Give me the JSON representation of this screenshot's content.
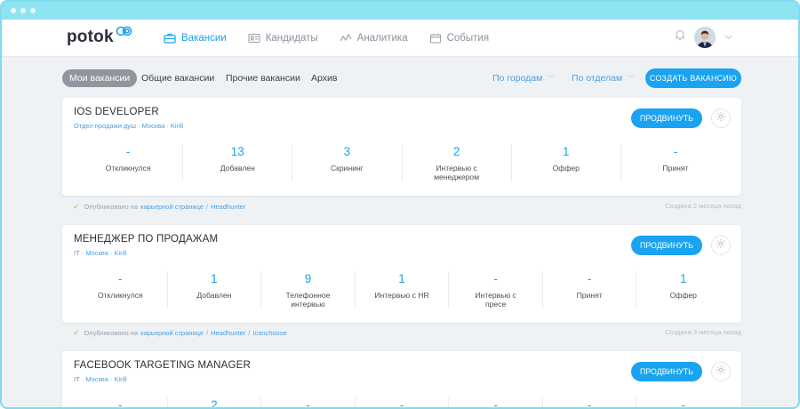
{
  "nav": {
    "logo": "potok",
    "items": [
      {
        "label": "Вакансии",
        "active": true,
        "icon": "briefcase-icon"
      },
      {
        "label": "Кандидаты",
        "active": false,
        "icon": "id-card-icon"
      },
      {
        "label": "Аналитика",
        "active": false,
        "icon": "analytics-icon"
      },
      {
        "label": "События",
        "active": false,
        "icon": "calendar-icon"
      }
    ]
  },
  "filters": {
    "tabs": [
      "Мои вакансии",
      "Общие вакансии",
      "Прочие вакансии",
      "Архив"
    ],
    "active_tab": "Мои вакансии",
    "city_filter": "По городам",
    "dept_filter": "По отделам",
    "create_button": "СОЗДАТЬ ВАКАНСИЮ"
  },
  "vacancies": [
    {
      "title": "IOS DEVELOPER",
      "meta": "Отдел продажи душ · Москва · Kirill",
      "promote": "ПРОДВИНУТЬ",
      "stages": [
        {
          "count": "-",
          "label": "Откликнулся"
        },
        {
          "count": "13",
          "label": "Добавлен"
        },
        {
          "count": "3",
          "label": "Скрининг"
        },
        {
          "count": "2",
          "label": "Интервью с менеджером"
        },
        {
          "count": "1",
          "label": "Оффер"
        },
        {
          "count": "-",
          "label": "Принят"
        }
      ],
      "published": {
        "prefix": "Опубликовано на",
        "links": [
          "карьерной странице",
          "Headhunter"
        ],
        "created": "Создана 2 месяца назад"
      }
    },
    {
      "title": "МЕНЕДЖЕР ПО ПРОДАЖАМ",
      "meta": "IT · Москва · Kirill",
      "promote": "ПРОДВИНУТЬ",
      "stages": [
        {
          "count": "-",
          "label": "Откликнулся"
        },
        {
          "count": "1",
          "label": "Добавлен"
        },
        {
          "count": "9",
          "label": "Телефонное интервью"
        },
        {
          "count": "1",
          "label": "Интервью с HR"
        },
        {
          "count": "-",
          "label": "Интервью с пресе"
        },
        {
          "count": "-",
          "label": "Принят"
        },
        {
          "count": "1",
          "label": "Оффер"
        }
      ],
      "published": {
        "prefix": "Опубликовано на",
        "links": [
          "карьерной странице",
          "Headhunter",
          "Icanchoose"
        ],
        "created": "Создана 3 месяца назад"
      }
    },
    {
      "title": "FACEBOOK TARGETING MANAGER",
      "meta": "IT · Москва · Kirill",
      "promote": "ПРОДВИНУТЬ",
      "stages": [
        {
          "count": "-",
          "label": ""
        },
        {
          "count": "2",
          "label": ""
        },
        {
          "count": "-",
          "label": ""
        },
        {
          "count": "-",
          "label": ""
        },
        {
          "count": "-",
          "label": ""
        },
        {
          "count": "-",
          "label": ""
        },
        {
          "count": "-",
          "label": ""
        }
      ]
    }
  ],
  "colors": {
    "accent": "#1aa3f0",
    "link": "#4a9ee0",
    "frame": "#8ee3f1",
    "check": "#8fd04a"
  }
}
